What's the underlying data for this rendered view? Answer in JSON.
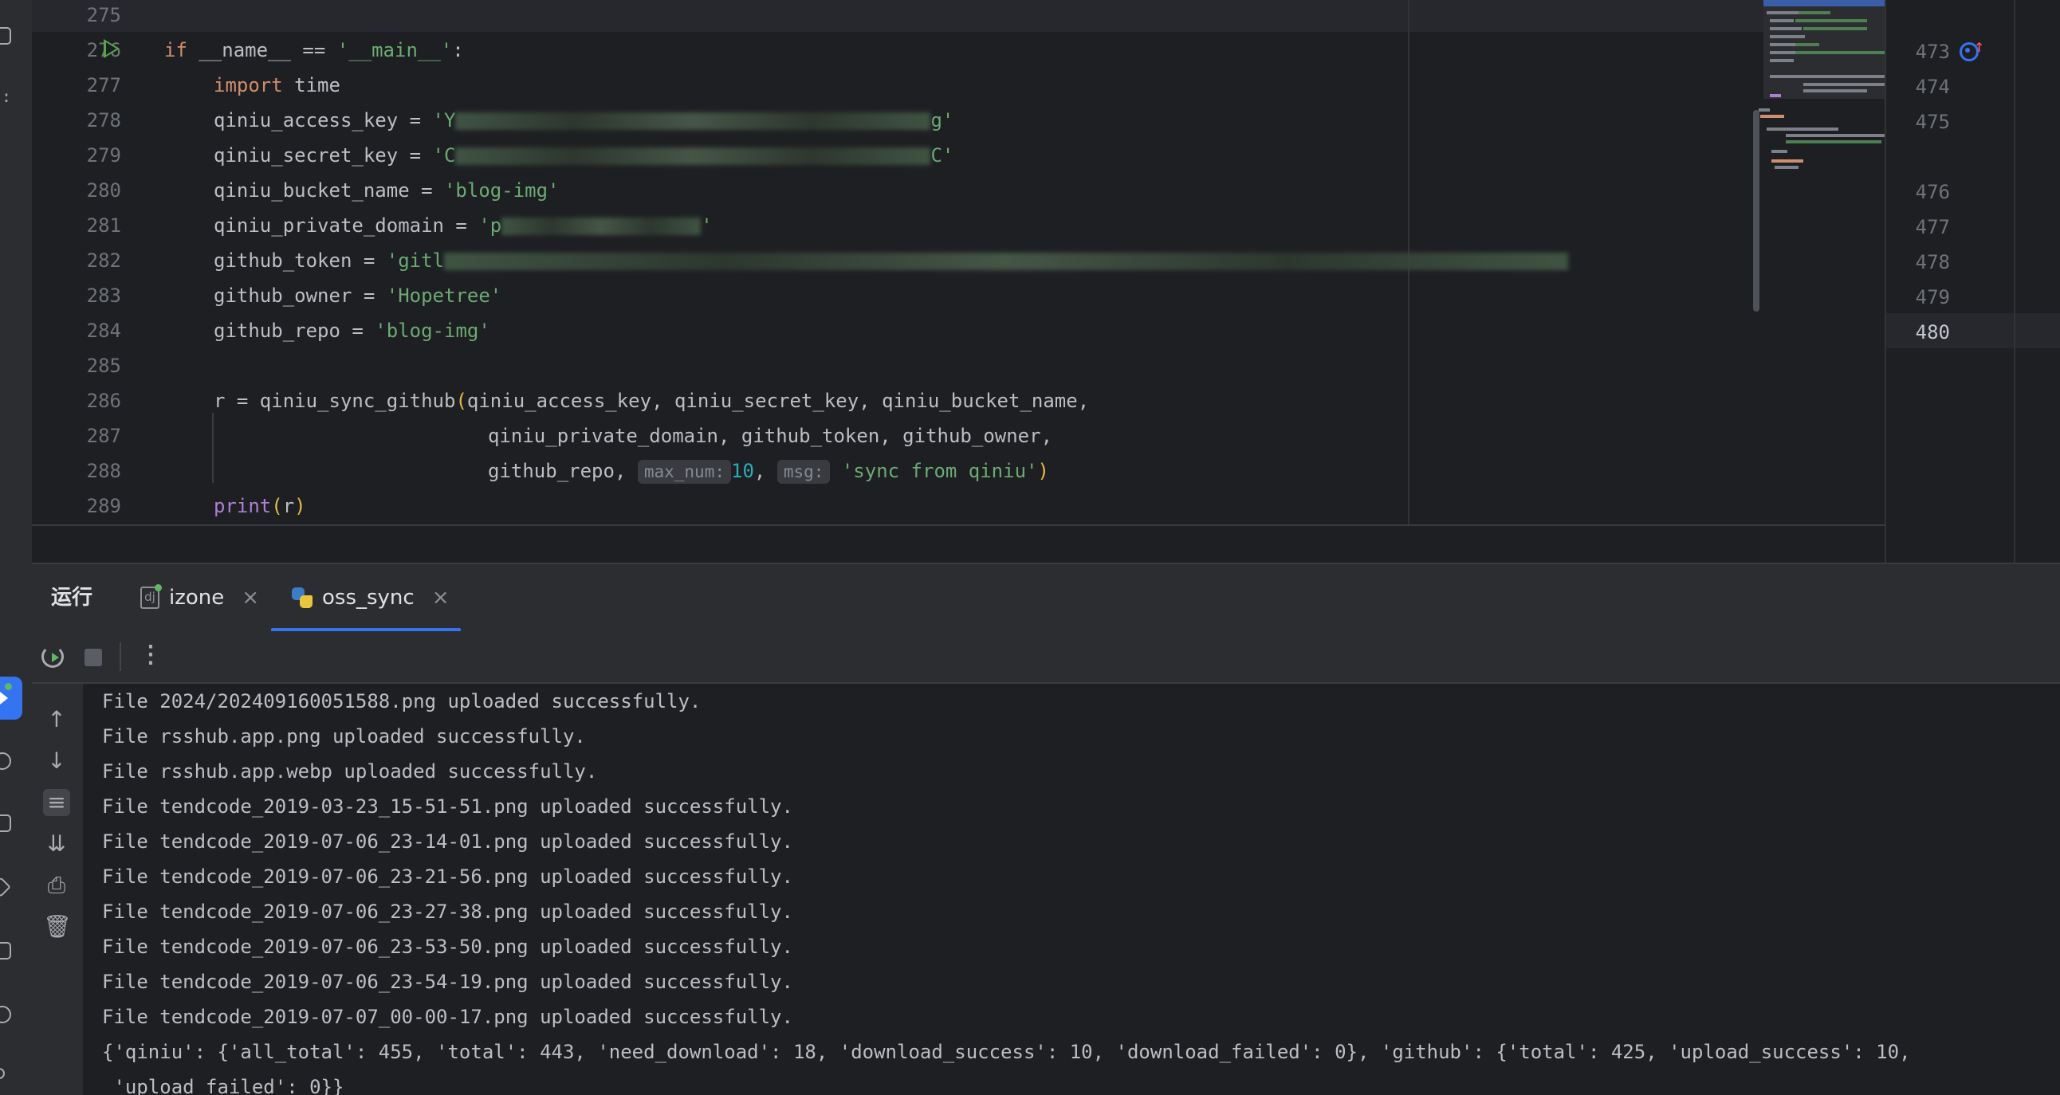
{
  "editor": {
    "line_numbers": [
      "275",
      "276",
      "277",
      "278",
      "279",
      "280",
      "281",
      "282",
      "283",
      "284",
      "285",
      "286",
      "287",
      "288",
      "289"
    ],
    "lines": {
      "l276": {
        "kw_if": "if",
        "name": " __name__ == ",
        "main_str": "'__main__'",
        "colon": ":"
      },
      "l277": {
        "kw_import": "import",
        "mod": " time"
      },
      "l278": {
        "var": "qiniu_access_key = ",
        "q_open": "'Y",
        "q_close": "g'"
      },
      "l279": {
        "var": "qiniu_secret_key = ",
        "q_open": "'C",
        "q_close": "C'"
      },
      "l280": {
        "var": "qiniu_bucket_name = ",
        "val": "'blog-img'"
      },
      "l281": {
        "var": "qiniu_private_domain = ",
        "q_open": "'p",
        "q_close": "'"
      },
      "l282": {
        "var": "github_token = ",
        "q_open": "'gitl"
      },
      "l283": {
        "var": "github_owner = ",
        "val": "'Hopetree'"
      },
      "l284": {
        "var": "github_repo = ",
        "val": "'blog-img'"
      },
      "l286": {
        "prefix": "r = qiniu_sync_github",
        "paren": "(",
        "args": "qiniu_access_key, qiniu_secret_key, qiniu_bucket_name,"
      },
      "l287": {
        "args": "qiniu_private_domain, github_token, github_owner,"
      },
      "l288": {
        "args": "github_repo, ",
        "hint1": "max_num:",
        "num": "10",
        "comma": ", ",
        "hint2": "msg:",
        "str": "'sync from qiniu'",
        "paren": ")"
      },
      "l289": {
        "fn": "print",
        "open": "(",
        "arg": "r",
        "close": ")"
      }
    }
  },
  "right_panel": {
    "line_numbers": [
      "473",
      "474",
      "475",
      "476",
      "477",
      "478",
      "479",
      "480"
    ]
  },
  "run_window": {
    "title": "运行",
    "tabs": [
      {
        "label": "izone",
        "icon": "django-icon"
      },
      {
        "label": "oss_sync",
        "icon": "python-icon"
      }
    ],
    "active_tab": "oss_sync",
    "console_lines": [
      "File 2024/202409160051588.png uploaded successfully.",
      "File rsshub.app.png uploaded successfully.",
      "File rsshub.app.webp uploaded successfully.",
      "File tendcode_2019-03-23_15-51-51.png uploaded successfully.",
      "File tendcode_2019-07-06_23-14-01.png uploaded successfully.",
      "File tendcode_2019-07-06_23-21-56.png uploaded successfully.",
      "File tendcode_2019-07-06_23-27-38.png uploaded successfully.",
      "File tendcode_2019-07-06_23-53-50.png uploaded successfully.",
      "File tendcode_2019-07-06_23-54-19.png uploaded successfully.",
      "File tendcode_2019-07-07_00-00-17.png uploaded successfully.",
      "{'qiniu': {'all_total': 455, 'total': 443, 'need_download': 18, 'download_success': 10, 'download_failed': 0}, 'github': {'total': 425, 'upload_success': 10,",
      " 'upload_failed': 0}}"
    ]
  },
  "colors": {
    "background": "#1e1f22",
    "keyword": "#cf8e6d",
    "string": "#6aab73",
    "number": "#2aacb8",
    "accent": "#3574f0"
  }
}
